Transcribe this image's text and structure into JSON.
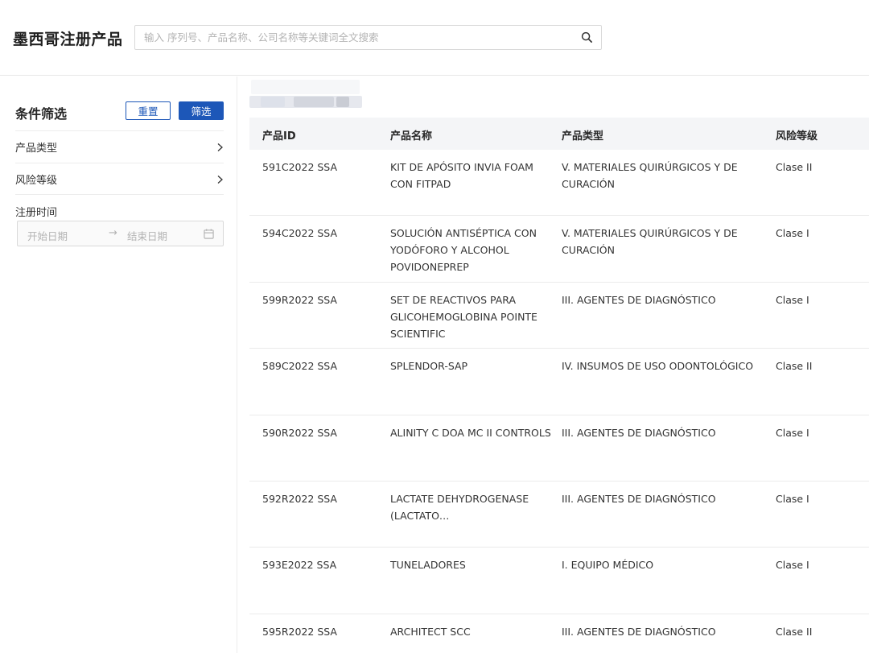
{
  "header": {
    "title": "墨西哥注册产品",
    "search_placeholder": "输入 序列号、产品名称、公司名称等关键词全文搜索",
    "search_icon": "search-icon"
  },
  "sidebar": {
    "title": "条件筛选",
    "reset_label": "重置",
    "filter_label": "筛选",
    "product_type_label": "产品类型",
    "risk_level_label": "风险等级",
    "reg_time_label": "注册时间",
    "date_start_placeholder": "开始日期",
    "date_arrow": "→",
    "date_end_placeholder": "结束日期"
  },
  "table": {
    "columns": [
      "产品ID",
      "产品名称",
      "产品类型",
      "风险等级"
    ],
    "rows": [
      {
        "id": "591C2022 SSA",
        "name": "KIT DE APÓSITO INVIA FOAM CON FITPAD",
        "type": "V. MATERIALES QUIRÚRGICOS Y DE CURACIÓN",
        "risk": "Clase II"
      },
      {
        "id": "594C2022 SSA",
        "name": "SOLUCIÓN ANTISÉPTICA CON YODÓFORO Y ALCOHOL POVIDONEPREP",
        "type": "V. MATERIALES QUIRÚRGICOS Y DE CURACIÓN",
        "risk": "Clase I"
      },
      {
        "id": "599R2022 SSA",
        "name": "SET DE REACTIVOS PARA GLICOHEMOGLOBINA POINTE SCIENTIFIC",
        "type": "III. AGENTES DE DIAGNÓSTICO",
        "risk": "Clase I"
      },
      {
        "id": "589C2022 SSA",
        "name": "SPLENDOR-SAP",
        "type": "IV. INSUMOS DE USO ODONTOLÓGICO",
        "risk": "Clase II"
      },
      {
        "id": "590R2022 SSA",
        "name": "ALINITY C DOA MC II CONTROLS",
        "type": "III. AGENTES DE DIAGNÓSTICO",
        "risk": "Clase I"
      },
      {
        "id": "592R2022 SSA",
        "name": "LACTATE DEHYDROGENASE (LACTATO…",
        "type": "III. AGENTES DE DIAGNÓSTICO",
        "risk": "Clase I"
      },
      {
        "id": "593E2022 SSA",
        "name": "TUNELADORES",
        "type": "I. EQUIPO MÉDICO",
        "risk": "Clase I"
      },
      {
        "id": "595R2022 SSA",
        "name": "ARCHITECT SCC",
        "type": "III. AGENTES DE DIAGNÓSTICO",
        "risk": "Clase II"
      }
    ]
  },
  "colors": {
    "accent": "#1d57b8",
    "header_bg": "#f4f5f7",
    "border": "#ececec"
  }
}
